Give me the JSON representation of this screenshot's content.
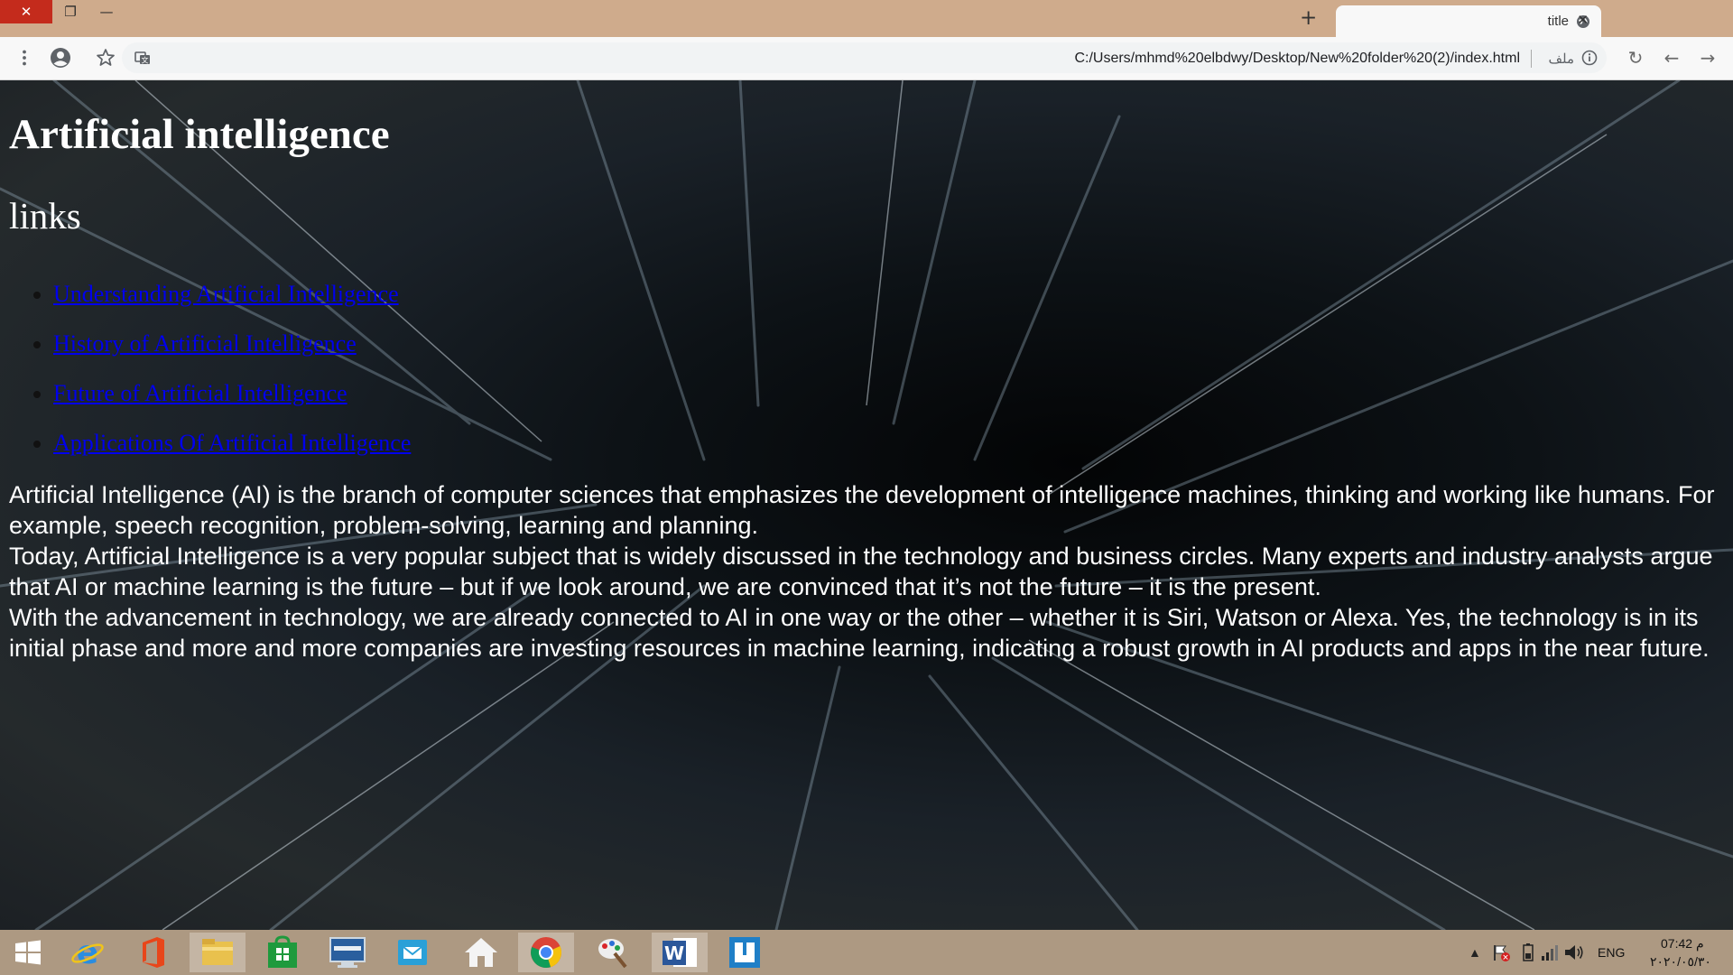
{
  "browser": {
    "tab_title": "title",
    "new_tab_label": "+",
    "tab_close_label": "✕",
    "address_url": "C:/Users/mhmd%20elbdwy/Desktop/New%20folder%20(2)/index.html",
    "scheme_label": "ملف",
    "window_controls": {
      "minimize": "—",
      "maximize": "❐",
      "close": "✕"
    }
  },
  "page": {
    "title": "Artificial intelligence",
    "links_heading": "links",
    "links": [
      "Understanding Artificial Intelligence",
      "History of Artificial Intelligence",
      "Future of Artificial Intelligence",
      "Applications Of Artificial Intelligence"
    ],
    "paragraph_1": "Artificial Intelligence (AI) is the branch of computer sciences that emphasizes the development of intelligence machines, thinking and working like humans. For example, speech recognition, problem-solving, learning and planning.",
    "paragraph_2": "Today, Artificial Intelligence is a very popular subject that is widely discussed in the technology and business circles. Many experts and industry analysts argue that AI or machine learning is the future – but if we look around, we are convinced that it’s not the future – it is the present.",
    "paragraph_3": "With the advancement in technology, we are already connected to AI in one way or the other – whether it is Siri, Watson or Alexa. Yes, the technology is in its initial phase and more and more companies are investing resources in machine learning, indicating a robust growth in AI products and apps in the near future."
  },
  "taskbar": {
    "apps": [
      "start-icon",
      "internet-explorer-icon",
      "office-icon",
      "file-explorer-icon",
      "store-icon",
      "lenovo-icon",
      "mail-icon",
      "home-icon",
      "chrome-icon",
      "paint-icon",
      "word-icon",
      "app-icon"
    ],
    "language": "ENG",
    "time": "07:42 م",
    "date": "٢٠٢٠/٠٥/٣٠"
  },
  "colors": {
    "titlebar": "#cfab8c",
    "taskbar": "#ad9982",
    "link": "#0000ee",
    "close_button": "#c42b1c"
  }
}
